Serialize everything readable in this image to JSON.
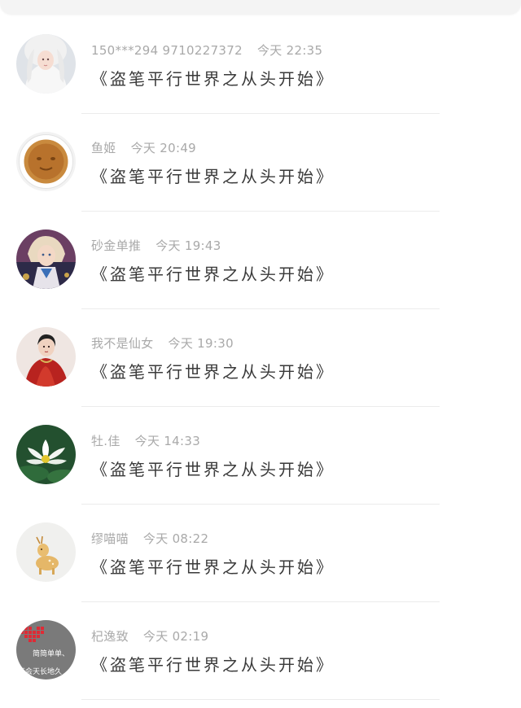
{
  "messages": [
    {
      "name": "150***294 9710227372",
      "time": "今天 22:35",
      "text": "《盗笔平行世界之从头开始》",
      "avatar": "avatar-girl-white-icon"
    },
    {
      "name": "鱼姬",
      "time": "今天 20:49",
      "text": "《盗笔平行世界之从头开始》",
      "avatar": "avatar-pudding-icon"
    },
    {
      "name": "砂金单推",
      "time": "今天 19:43",
      "text": "《盗笔平行世界之从头开始》",
      "avatar": "avatar-anime-boy-icon"
    },
    {
      "name": "我不是仙女",
      "time": "今天 19:30",
      "text": "《盗笔平行世界之从头开始》",
      "avatar": "avatar-woman-red-icon"
    },
    {
      "name": "牡.佳",
      "time": "今天 14:33",
      "text": "《盗笔平行世界之从头开始》",
      "avatar": "avatar-lotus-icon"
    },
    {
      "name": "缪喵喵",
      "time": "今天 08:22",
      "text": "《盗笔平行世界之从头开始》",
      "avatar": "avatar-deer-icon"
    },
    {
      "name": "杞逸致",
      "time": "今天 02:19",
      "text": "《盗笔平行世界之从头开始》",
      "avatar": "avatar-heart-text-icon",
      "avatar_caption": [
        "简简单单、",
        "不会天长地久"
      ]
    }
  ]
}
